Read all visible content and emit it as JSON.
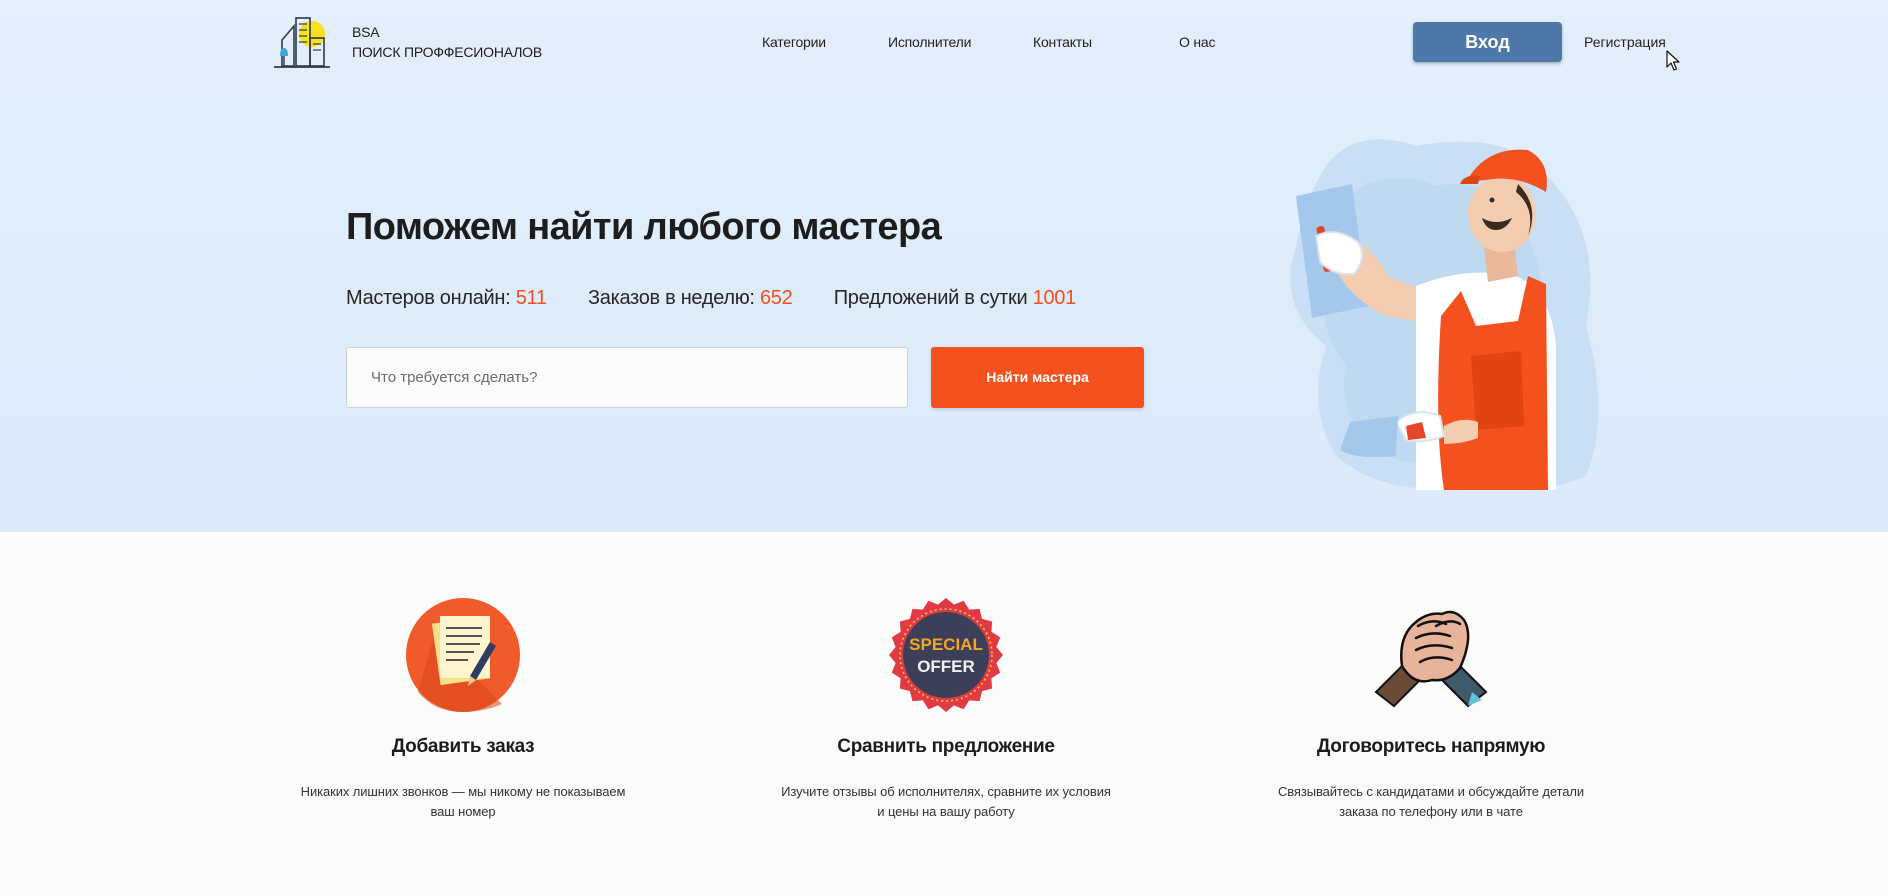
{
  "header": {
    "brand_line1": "BSA",
    "brand_line2": "ПОИСК ПРОФФЕСИОНАЛОВ",
    "nav": [
      "Категории",
      "Исполнители",
      "Контакты",
      "О нас"
    ],
    "login_label": "Вход",
    "register_label": "Регистрация"
  },
  "hero": {
    "title": "Поможем найти любого мастера",
    "stats": [
      {
        "label": "Мастеров онлайн:",
        "value": "511"
      },
      {
        "label": "Заказов в неделю:",
        "value": "652"
      },
      {
        "label": "Предложений в сутки",
        "value": "1001"
      }
    ],
    "search_placeholder": "Что требуется сделать?",
    "search_button": "Найти мастера"
  },
  "features": [
    {
      "title": "Добавить заказ",
      "text": "Никаких лишних звонков — мы никому не показываем ваш номер",
      "icon": "document-pen-icon"
    },
    {
      "title": "Сравнить предложение",
      "text": "Изучите отзывы об исполнителях, сравните их условия и цены на вашу работу",
      "icon": "special-offer-badge-icon",
      "badge_line1": "SPECIAL",
      "badge_line2": "OFFER"
    },
    {
      "title": "Договоритесь напрямую",
      "text": "Связывайтесь с кандидатами и обсуждайте детали заказа по телефону или в чате",
      "icon": "handshake-icon"
    }
  ],
  "colors": {
    "accent_orange": "#f4511e",
    "login_blue": "#4d78a9",
    "hero_background": "#e1edfa",
    "stat_number": "#f05022"
  }
}
